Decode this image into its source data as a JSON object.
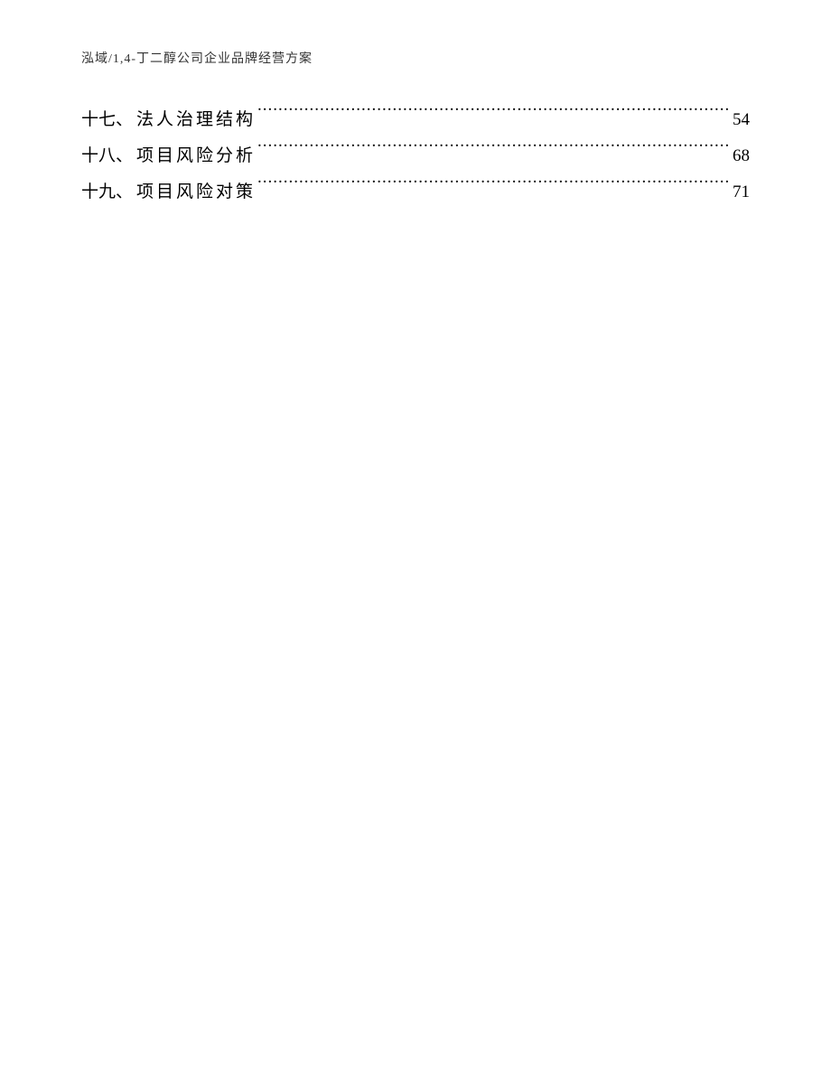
{
  "header": "泓域/1,4-丁二醇公司企业品牌经营方案",
  "toc": {
    "entries": [
      {
        "num": "十七",
        "sep": "、",
        "title": "法人治理结构",
        "page": "54"
      },
      {
        "num": "十八",
        "sep": "、",
        "title": "项目风险分析",
        "page": "68"
      },
      {
        "num": "十九",
        "sep": "、",
        "title": "项目风险对策",
        "page": "71"
      }
    ]
  }
}
